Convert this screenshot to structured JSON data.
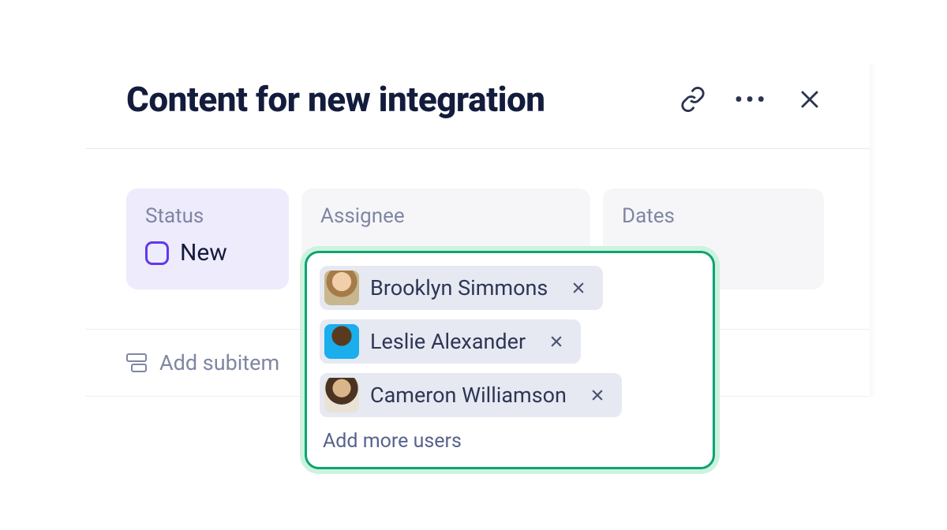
{
  "header": {
    "title": "Content for new integration"
  },
  "fields": {
    "status": {
      "label": "Status",
      "value": "New"
    },
    "assignee": {
      "label": "Assignee"
    },
    "dates": {
      "label": "Dates"
    }
  },
  "subitem": {
    "label": "Add subitem"
  },
  "assignee_dropdown": {
    "users": [
      {
        "name": "Brooklyn Simmons"
      },
      {
        "name": "Leslie Alexander"
      },
      {
        "name": "Cameron Williamson"
      }
    ],
    "add_more": "Add more users"
  }
}
